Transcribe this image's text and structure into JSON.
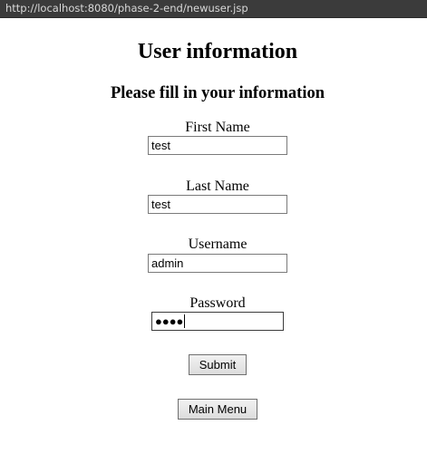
{
  "browser": {
    "url": "http://localhost:8080/phase-2-end/newuser.jsp"
  },
  "page": {
    "title": "User information",
    "subtitle": "Please fill in your information"
  },
  "form": {
    "first_name_label": "First Name",
    "first_name_value": "test",
    "last_name_label": "Last Name",
    "last_name_value": "test",
    "username_label": "Username",
    "username_value": "admin",
    "password_label": "Password",
    "password_masked": "●●●●",
    "submit_label": "Submit",
    "main_menu_label": "Main Menu"
  }
}
